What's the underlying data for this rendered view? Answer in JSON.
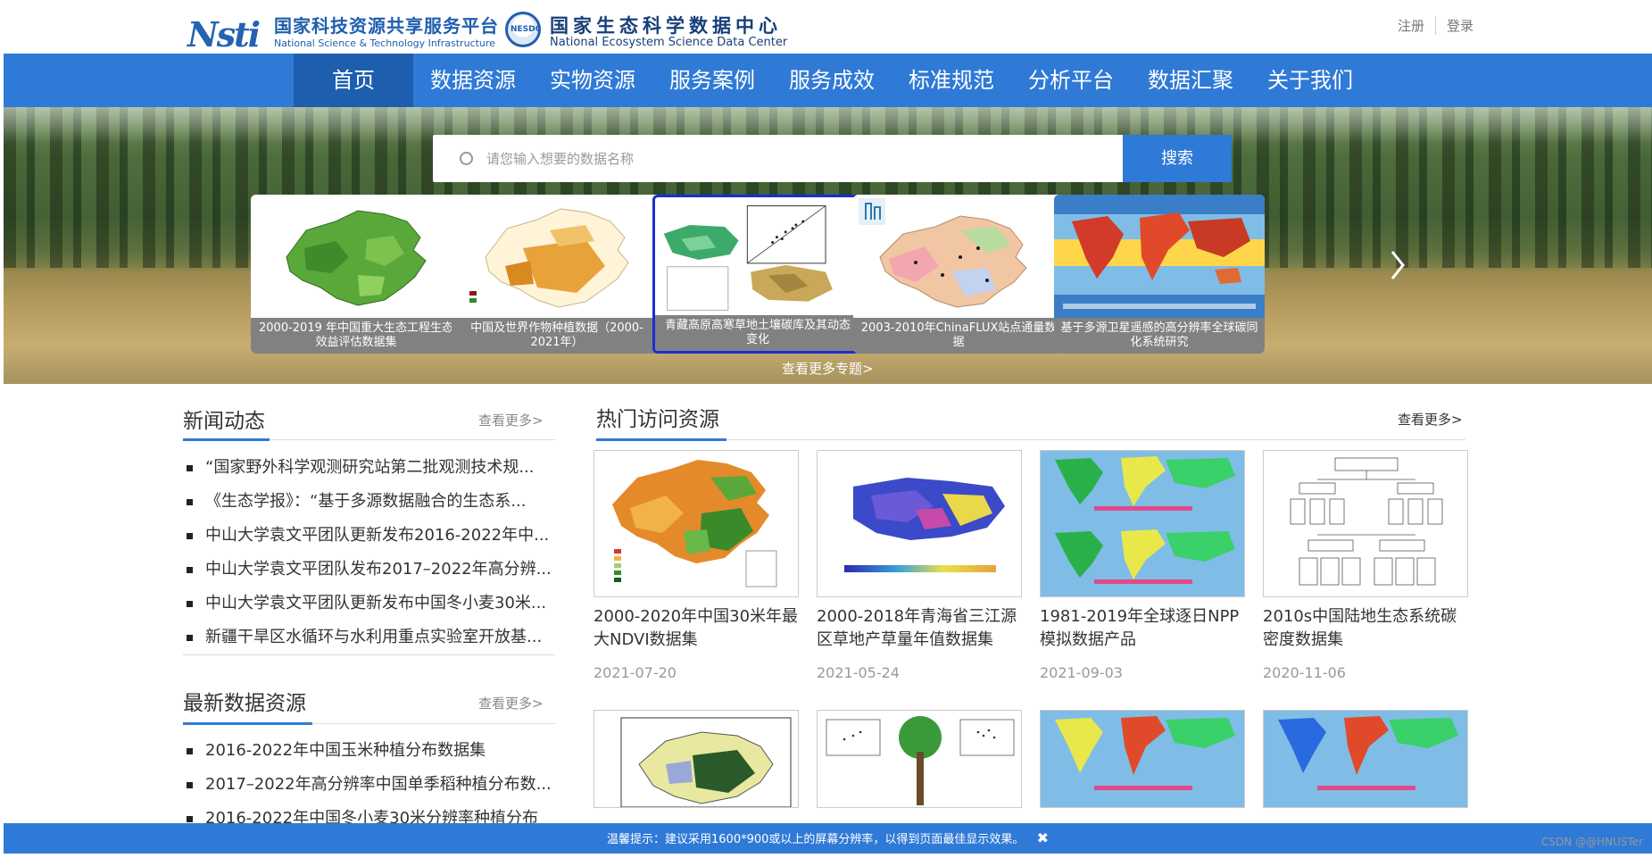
{
  "header": {
    "logo1_mark": "Nsti",
    "logo1_zh": "国家科技资源共享服务平台",
    "logo1_en": "National Science & Technology Infrastructure",
    "logo2_mark": "NESDC",
    "logo2_zh": "国家生态科学数据中心",
    "logo2_en": "National Ecosystem Science Data Center",
    "register": "注册",
    "login": "登录"
  },
  "nav": {
    "items": [
      {
        "label": "首页",
        "active": true
      },
      {
        "label": "数据资源"
      },
      {
        "label": "实物资源"
      },
      {
        "label": "服务案例"
      },
      {
        "label": "服务成效"
      },
      {
        "label": "标准规范"
      },
      {
        "label": "分析平台"
      },
      {
        "label": "数据汇聚"
      },
      {
        "label": "关于我们"
      }
    ]
  },
  "search": {
    "placeholder": "请您输入想要的数据名称",
    "button": "搜索"
  },
  "topics": {
    "items": [
      {
        "caption": "2000-2019 年中国重大生态工程生态效益评估数据集"
      },
      {
        "caption": "中国及世界作物种植数据（2000-2021年）"
      },
      {
        "caption": "青藏高原高寒草地土壤碳库及其动态变化"
      },
      {
        "caption": "2003-2010年ChinaFLUX站点通量数据"
      },
      {
        "caption": "基于多源卫星遥感的高分辨率全球碳同化系统研究"
      }
    ],
    "more": "查看更多专题>"
  },
  "news": {
    "title": "新闻动态",
    "more": "查看更多>",
    "items": [
      "“国家野外科学观测研究站第二批观测技术规...",
      "《生态学报》：“基于多源数据融合的生态系...",
      "中山大学袁文平团队更新发布2016-2022年中...",
      "中山大学袁文平团队发布2017–2022年高分辨...",
      "中山大学袁文平团队更新发布中国冬小麦30米...",
      "新疆干旱区水循环与水利用重点实验室开放基..."
    ]
  },
  "latest": {
    "title": "最新数据资源",
    "more": "查看更多>",
    "items": [
      "2016-2022年中国玉米种植分布数据集",
      "2017–2022年高分辨率中国单季稻种植分布数...",
      "2016-2022年中国冬小麦30米分辨率种植分布"
    ]
  },
  "popular": {
    "title": "热门访问资源",
    "more": "查看更多>",
    "cards": [
      {
        "name": "2000-2020年中国30米年最大NDVI数据集",
        "date": "2021-07-20"
      },
      {
        "name": "2000-2018年青海省三江源区草地产草量年值数据集",
        "date": "2021-05-24"
      },
      {
        "name": "1981-2019年全球逐日NPP模拟数据产品",
        "date": "2021-09-03"
      },
      {
        "name": "2010s中国陆地生态系统碳密度数据集",
        "date": "2020-11-06"
      }
    ]
  },
  "notice": {
    "text": "温馨提示：建议采用1600*900或以上的屏幕分辨率，以得到页面最佳显示效果。",
    "close": "✖"
  },
  "watermark": "CSDN @@HNUSTer",
  "colors": {
    "brand_blue": "#2f7ad6",
    "nav_active": "#1d5fae",
    "selected_border": "#1a2fd0"
  }
}
